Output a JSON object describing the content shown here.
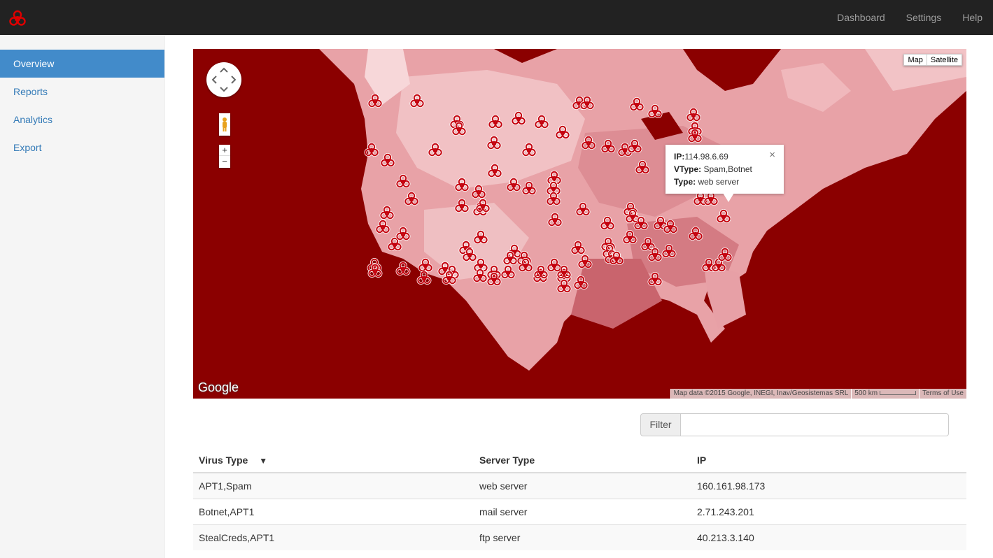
{
  "navbar": {
    "brand_icon": "biohazard-icon",
    "links": [
      "Dashboard",
      "Settings",
      "Help"
    ]
  },
  "sidebar": {
    "items": [
      {
        "label": "Overview",
        "active": true
      },
      {
        "label": "Reports",
        "active": false
      },
      {
        "label": "Analytics",
        "active": false
      },
      {
        "label": "Export",
        "active": false
      }
    ]
  },
  "map": {
    "type_buttons": [
      "Map",
      "Satellite"
    ],
    "zoom_in": "+",
    "zoom_out": "−",
    "logo": "Google",
    "attribution": "Map data ©2015 Google, INEGI, Inav/Geosistemas SRL",
    "scale": "500 km",
    "terms": "Terms of Use",
    "marker_icon": "biohazard-icon",
    "info": {
      "ip_label": "IP:",
      "ip": "114.98.6.69",
      "vtype_label": "VType:",
      "vtype": "Spam,Botnet",
      "type_label": "Type:",
      "type": "web server",
      "close": "×"
    }
  },
  "filter": {
    "label": "Filter",
    "value": ""
  },
  "table": {
    "headers": [
      "Virus Type",
      "Server Type",
      "IP"
    ],
    "sort_indicator": "▼",
    "rows": [
      [
        "APT1,Spam",
        "web server",
        "160.161.98.173"
      ],
      [
        "Botnet,APT1",
        "mail server",
        "2.71.243.201"
      ],
      [
        "StealCreds,APT1",
        "ftp server",
        "40.213.3.140"
      ]
    ]
  }
}
